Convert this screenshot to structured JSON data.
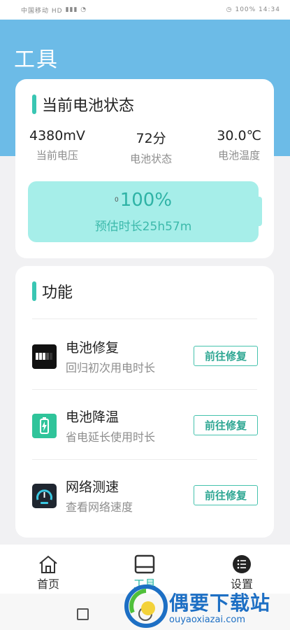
{
  "status_bar": {
    "left_text": "中国移动 HD",
    "right_text": "100% 14:34"
  },
  "header": {
    "title": "工具"
  },
  "battery_card": {
    "title": "当前电池状态",
    "stats": [
      {
        "value": "4380mV",
        "label": "当前电压"
      },
      {
        "value": "72分",
        "label": "电池状态"
      },
      {
        "value": "30.0℃",
        "label": "电池温度"
      }
    ],
    "charging_mark": "0",
    "percent": "100%",
    "level_fraction": 1.0,
    "estimate": "预估时长25h57m"
  },
  "features_card": {
    "title": "功能",
    "items": [
      {
        "name": "电池修复",
        "desc": "回归初次用电时长",
        "button": "前往修复",
        "icon": "battery-repair-icon"
      },
      {
        "name": "电池降温",
        "desc": "省电延长使用时长",
        "button": "前往修复",
        "icon": "battery-cool-icon"
      },
      {
        "name": "网络测速",
        "desc": "查看网络速度",
        "button": "前往修复",
        "icon": "speedometer-icon"
      }
    ]
  },
  "tabbar": {
    "tabs": [
      {
        "label": "首页",
        "icon": "home-icon"
      },
      {
        "label": "工具",
        "icon": "tools-icon",
        "active": true
      },
      {
        "label": "设置",
        "icon": "settings-list-icon"
      }
    ]
  },
  "watermark": {
    "cn": "偶要下载站",
    "en": "ouyaoxiazai.com"
  },
  "colors": {
    "header_bg": "#6cbbe7",
    "accent": "#39c6b3",
    "battery_fill": "#a6eee9",
    "button_text": "#2fa793"
  }
}
